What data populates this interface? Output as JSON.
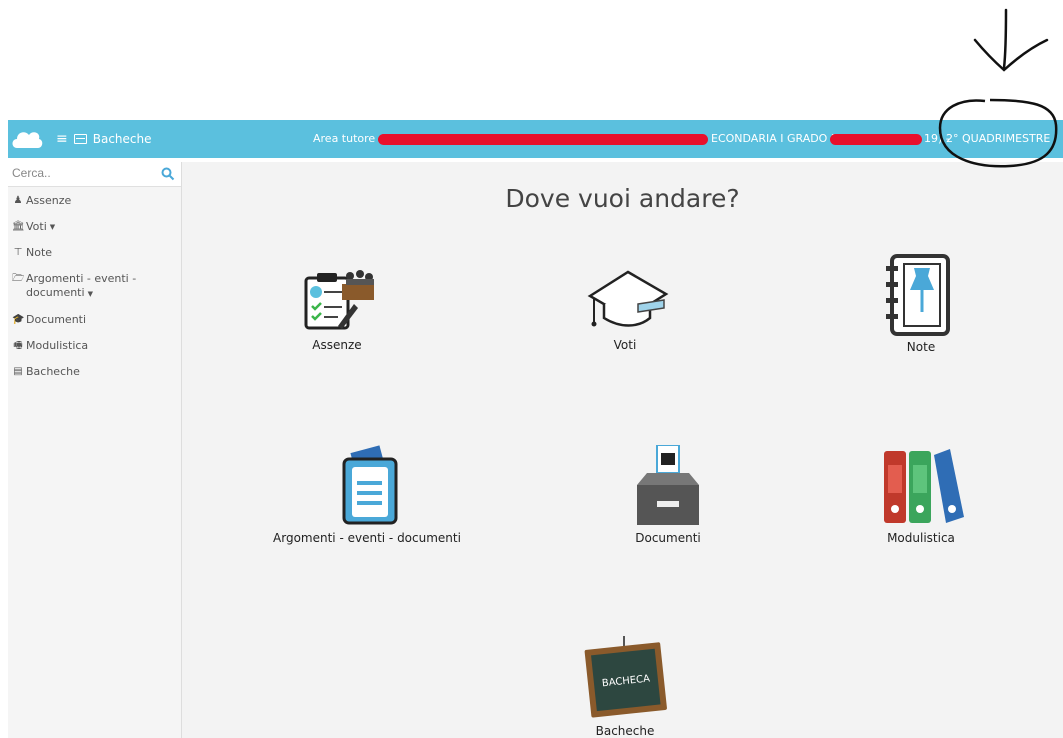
{
  "header": {
    "menu_label": "Bacheche",
    "area_prefix": "Area tutore",
    "school_text": "ECONDARIA I GRADO M",
    "period_suffix": "19) -",
    "period": "2° QUADRIMESTRE"
  },
  "sidebar": {
    "search_placeholder": "Cerca..",
    "items": [
      {
        "label": "Assenze",
        "icon": "user-icon"
      },
      {
        "label": "Voti",
        "icon": "bank-icon",
        "dropdown": true
      },
      {
        "label": "Note",
        "icon": "pin-icon"
      },
      {
        "label": "Argomenti - eventi - documenti",
        "icon": "folder-icon",
        "dropdown": true
      },
      {
        "label": "Documenti",
        "icon": "graduation-cap-icon"
      },
      {
        "label": "Modulistica",
        "icon": "fax-icon"
      },
      {
        "label": "Bacheche",
        "icon": "board-icon"
      }
    ]
  },
  "main": {
    "title": "Dove vuoi andare?",
    "tiles": [
      {
        "label": "Assenze"
      },
      {
        "label": "Voti"
      },
      {
        "label": "Note"
      },
      {
        "label": "Argomenti - eventi - documenti"
      },
      {
        "label": "Documenti"
      },
      {
        "label": "Modulistica"
      },
      {
        "label": "Bacheche",
        "board_text": "BACHECA"
      }
    ]
  },
  "colors": {
    "topbar": "#5bc0de",
    "redaction": "#e8102c",
    "background": "#f3f3f3"
  }
}
